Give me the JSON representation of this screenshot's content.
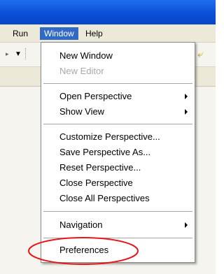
{
  "menubar": {
    "items": [
      {
        "label": "Run"
      },
      {
        "label": "Window",
        "active": true
      },
      {
        "label": "Help"
      }
    ]
  },
  "toolbar": {
    "left_arrow_icon": "dropdown-arrow-icon",
    "right_icon": "back-arrow-icon"
  },
  "window_menu": {
    "items": [
      {
        "label": "New Window",
        "enabled": true
      },
      {
        "label": "New Editor",
        "enabled": false
      },
      {
        "label": "Open Perspective",
        "enabled": true,
        "submenu": true
      },
      {
        "label": "Show View",
        "enabled": true,
        "submenu": true
      },
      {
        "label": "Customize Perspective...",
        "enabled": true
      },
      {
        "label": "Save Perspective As...",
        "enabled": true
      },
      {
        "label": "Reset Perspective...",
        "enabled": true
      },
      {
        "label": "Close Perspective",
        "enabled": true
      },
      {
        "label": "Close All Perspectives",
        "enabled": true
      },
      {
        "label": "Navigation",
        "enabled": true,
        "submenu": true
      },
      {
        "label": "Preferences",
        "enabled": true
      }
    ]
  },
  "annotation": {
    "color": "#e8151b",
    "target": "Preferences"
  }
}
